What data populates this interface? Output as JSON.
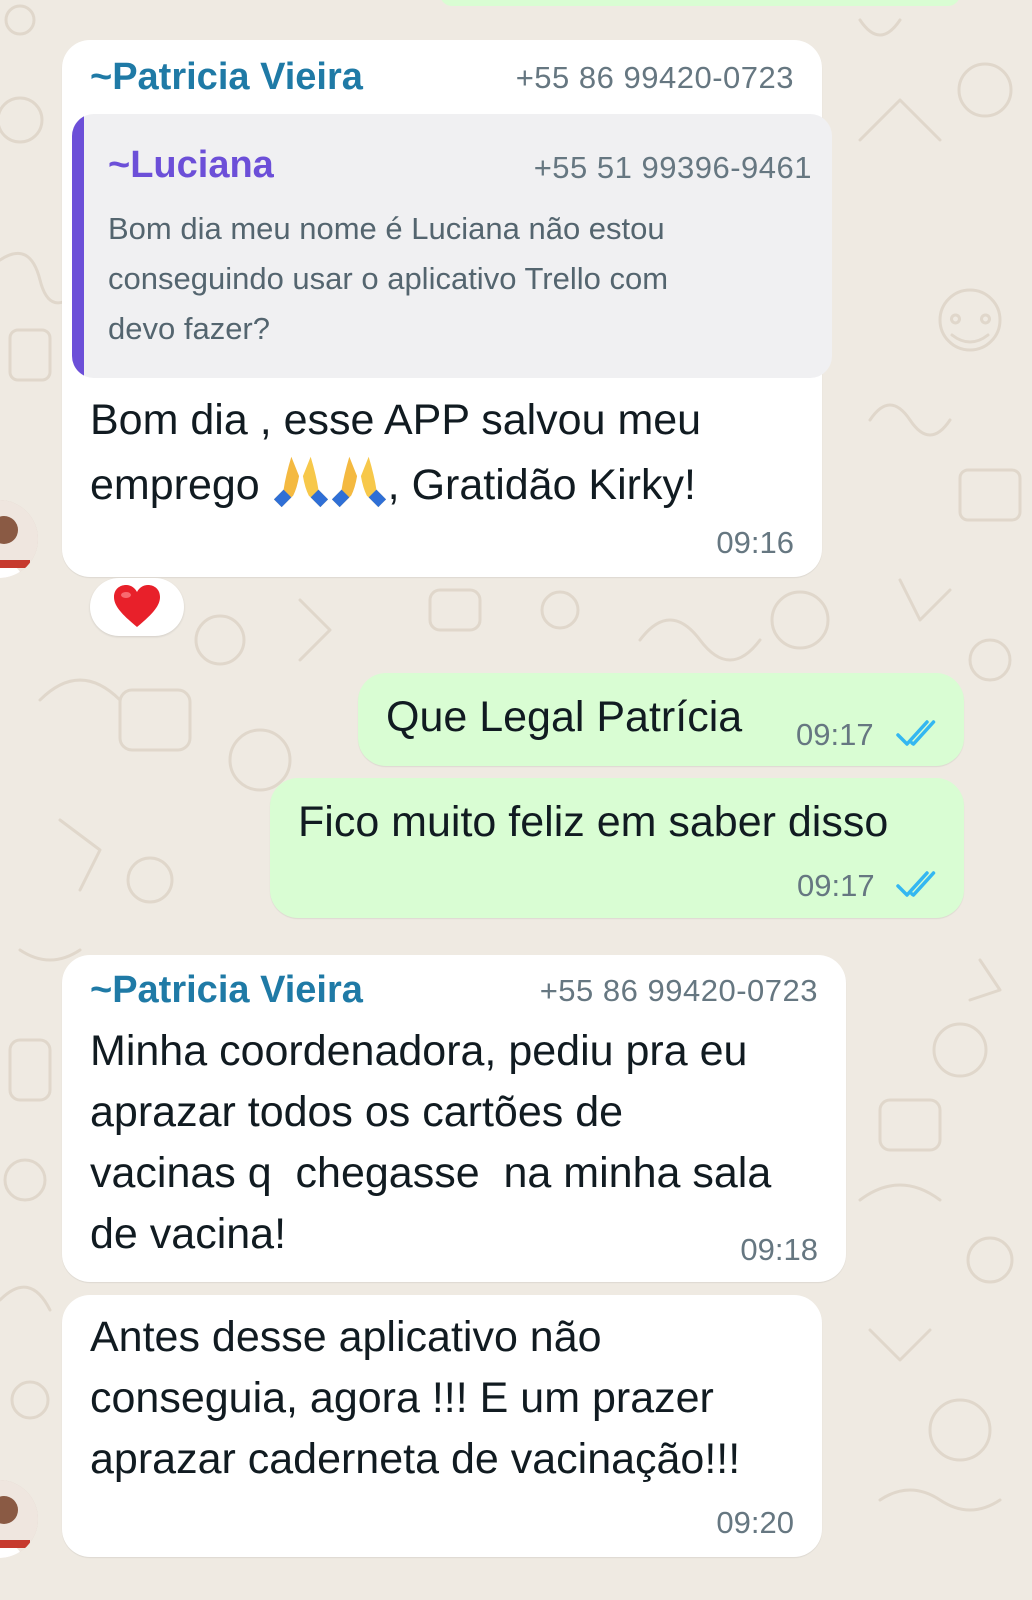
{
  "chat": {
    "colors": {
      "background": "#efeae2",
      "incoming_bubble": "#ffffff",
      "outgoing_bubble": "#d9fdd3",
      "sender_name": "#1f7aa6",
      "quote_accent": "#6c4fd8",
      "read_ticks": "#34b7f1"
    },
    "messages": [
      {
        "direction": "incoming",
        "sender_prefix": "~",
        "sender_name": "Patricia Vieira",
        "sender_phone": "+55 86 99420-0723",
        "quoted": {
          "prefix": "~",
          "name": "Luciana",
          "phone": "+55 51 99396-9461",
          "text_line_1": "Bom dia meu nome é Luciana não estou",
          "text_line_2": "conseguindo usar o aplicativo Trello com",
          "text_line_3": "devo fazer?"
        },
        "line_1": "Bom dia , esse APP salvou meu",
        "line_2_before": "emprego ",
        "line_2_after": ", Gratidão Kirky!",
        "emoji": "folded-hands-icon",
        "time": "09:16",
        "reaction": "heart-icon"
      },
      {
        "direction": "outgoing",
        "text": "Que Legal Patrícia",
        "time": "09:17",
        "status": "read"
      },
      {
        "direction": "outgoing",
        "text": "Fico muito feliz em saber disso",
        "time": "09:17",
        "status": "read"
      },
      {
        "direction": "incoming",
        "sender_prefix": "~",
        "sender_name": "Patricia Vieira",
        "sender_phone": "+55 86 99420-0723",
        "line_1": "Minha coordenadora, pediu pra eu",
        "line_2": "aprazar todos os cartões de",
        "line_3": "vacinas q  chegasse  na minha sala",
        "line_4": "de vacina!",
        "time": "09:18"
      },
      {
        "direction": "incoming",
        "line_1": "Antes desse aplicativo não",
        "line_2": "conseguia, agora !!! E um prazer",
        "line_3": "aprazar caderneta de vacinação!!!",
        "time": "09:20"
      }
    ]
  }
}
